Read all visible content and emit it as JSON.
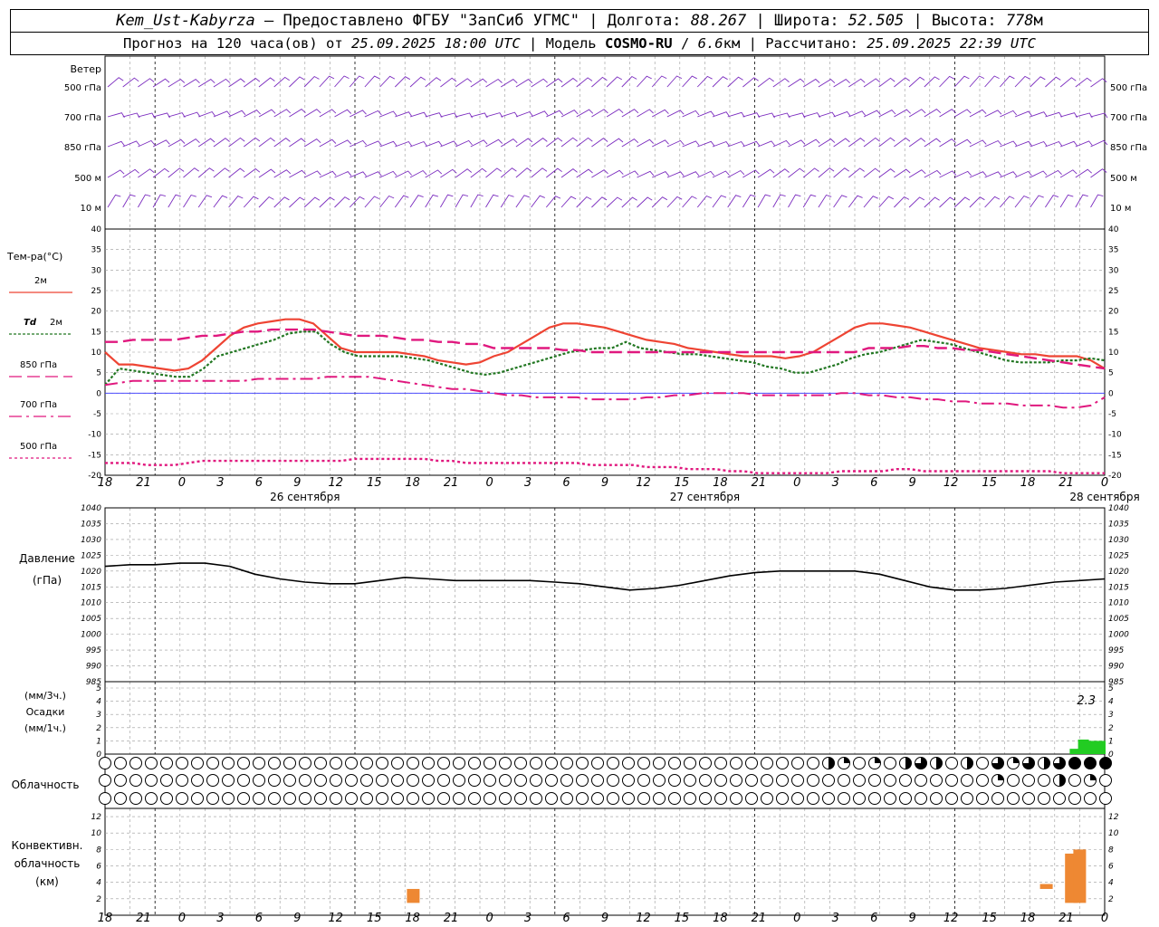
{
  "header": {
    "station": "Kem_Ust-Kabyrza",
    "provider_sep": " – Предоставлено ФГБУ \"ЗапСиб УГМС\" | Долгота: ",
    "lon": "88.267",
    "lat_label": " | Широта: ",
    "lat": "52.505",
    "alt_label": " | Высота: ",
    "alt": "778",
    "alt_unit": "м",
    "forecast_label": "Прогноз на 120 часа(ов) от ",
    "forecast_from": "25.09.2025 18:00 UTC",
    "model_label": "  | Модель ",
    "model": "COSMO-RU",
    "model_sep": " / ",
    "resolution": "6.6",
    "res_unit": "км",
    "calc_label": " | Рассчитано: ",
    "calculated": "25.09.2025 22:39 UTC"
  },
  "time_axis": {
    "tick_labels": [
      "18",
      "21",
      "0",
      "3",
      "6",
      "9",
      "12",
      "15",
      "18",
      "21",
      "0",
      "3",
      "6",
      "9",
      "12",
      "15",
      "18",
      "21",
      "0",
      "3",
      "6",
      "9",
      "12",
      "15",
      "18",
      "21",
      "0"
    ],
    "day_labels": [
      "26 сентября",
      "27 сентября",
      "28 сентября"
    ]
  },
  "labels": {
    "wind": "Ветер",
    "wind_levels": [
      "500 гПа",
      "700 гПа",
      "850 гПа",
      "500 м",
      "10 м"
    ],
    "temp_title": "Тем-ра(°C)",
    "temp_legend": [
      "2м",
      "Td 2м",
      "850 гПа",
      "700 гПа",
      "500 гПа"
    ],
    "pressure_title": "Давление",
    "pressure_unit": "(гПа)",
    "precip": [
      "(мм/3ч.)",
      "Осадки",
      "(мм/1ч.)"
    ],
    "precip_total": "2.3",
    "cloud": "Облачность",
    "conv": [
      "Конвективн.",
      "облачность",
      "(км)"
    ]
  },
  "colors": {
    "wind": "#7b2cbf",
    "t2m": "#ee4433",
    "td2m": "#227722",
    "t850": "#e0187e",
    "t700": "#e0187e",
    "t500": "#e0187e",
    "pressure": "#000000",
    "precip": "#22cc22",
    "conv": "#ee8833",
    "zero_line": "#3333ff",
    "grid": "#999999"
  },
  "chart_data": [
    {
      "type": "line",
      "name": "temperature",
      "x_hours": [
        0,
        3,
        6,
        9,
        12,
        15,
        18,
        21,
        24,
        27,
        30,
        33,
        36,
        39,
        42,
        45,
        48,
        51,
        54,
        57,
        60,
        63,
        66,
        69,
        72,
        75,
        78,
        81,
        84,
        87,
        90,
        93,
        96,
        99,
        102,
        105,
        108,
        111,
        114,
        117,
        120,
        123,
        126,
        129,
        132,
        135,
        138,
        141,
        144,
        147,
        150,
        153,
        156
      ],
      "ylim": [
        -20,
        40
      ],
      "ticks": [
        -20,
        -15,
        -10,
        -5,
        0,
        5,
        10,
        15,
        20,
        25,
        30,
        35,
        40
      ],
      "series": [
        {
          "name": "2м",
          "values": [
            10,
            7,
            7,
            6.5,
            6,
            5.5,
            6,
            8,
            11,
            14,
            16,
            17,
            17.5,
            18,
            18,
            17,
            14,
            11,
            10,
            10,
            10,
            10,
            9.5,
            9,
            8,
            7.5,
            7,
            7.5,
            9,
            10,
            12,
            14,
            16,
            17,
            17,
            16.5,
            16,
            15,
            14,
            13,
            12.5,
            12,
            11,
            10.5,
            10,
            9.5,
            9,
            9,
            9,
            8.5,
            9,
            10,
            12,
            14,
            16,
            17,
            17,
            16.5,
            16,
            15,
            14,
            13,
            12,
            11,
            10.5,
            10,
            9.5,
            9.5,
            9,
            9,
            9,
            8,
            6
          ]
        },
        {
          "name": "Td 2м",
          "values": [
            2,
            6,
            5.5,
            5,
            4.5,
            4,
            4,
            6,
            9,
            10,
            11,
            12,
            13,
            14.5,
            15,
            15,
            12,
            10,
            9,
            9,
            9,
            9,
            8.5,
            8,
            7,
            6,
            5,
            4.5,
            5,
            6,
            7,
            8,
            9,
            10,
            10.5,
            11,
            11,
            12.5,
            11,
            10.5,
            10,
            9.5,
            9.5,
            9,
            8.5,
            8,
            7.5,
            6.5,
            6,
            5,
            5,
            6,
            7,
            8.5,
            9.5,
            10,
            11,
            12,
            13,
            12.5,
            12,
            11,
            10,
            9,
            8,
            7.5,
            7.5,
            7.5,
            8,
            8,
            8.5,
            8
          ]
        },
        {
          "name": "850 гПа",
          "values": [
            12.5,
            12.5,
            13,
            13,
            13,
            13,
            13.5,
            14,
            14,
            14.5,
            15,
            15,
            15.5,
            15.5,
            15.5,
            15.5,
            15,
            14.5,
            14,
            14,
            14,
            13.5,
            13,
            13,
            12.5,
            12.5,
            12,
            12,
            11,
            11,
            11,
            11,
            11,
            10.5,
            10.5,
            10,
            10,
            10,
            10,
            10,
            10,
            10,
            10,
            10,
            10,
            10,
            10,
            10,
            10,
            10,
            10,
            10,
            10,
            10,
            10,
            11,
            11,
            11,
            11.5,
            11.5,
            11,
            11,
            10.5,
            10.5,
            10,
            9.5,
            9,
            8.5,
            8,
            7.5,
            7,
            6.5,
            6
          ]
        },
        {
          "name": "700 гПа",
          "values": [
            2,
            2.5,
            3,
            3,
            3,
            3,
            3,
            3,
            3,
            3,
            3,
            3.5,
            3.5,
            3.5,
            3.5,
            3.5,
            4,
            4,
            4,
            4,
            3.5,
            3,
            2.5,
            2,
            1.5,
            1,
            1,
            0.5,
            0,
            -0.5,
            -0.5,
            -1,
            -1,
            -1,
            -1,
            -1.5,
            -1.5,
            -1.5,
            -1.5,
            -1,
            -1,
            -0.5,
            -0.5,
            0,
            0,
            0,
            0,
            -0.5,
            -0.5,
            -0.5,
            -0.5,
            -0.5,
            -0.5,
            0,
            0,
            -0.5,
            -0.5,
            -1,
            -1,
            -1.5,
            -1.5,
            -2,
            -2,
            -2.5,
            -2.5,
            -2.5,
            -3,
            -3,
            -3,
            -3.5,
            -3.5,
            -3,
            -1
          ]
        },
        {
          "name": "500 гПа",
          "values": [
            -17,
            -17,
            -17,
            -17.5,
            -17.5,
            -17.5,
            -17,
            -16.5,
            -16.5,
            -16.5,
            -16.5,
            -16.5,
            -16.5,
            -16.5,
            -16.5,
            -16.5,
            -16.5,
            -16.5,
            -16,
            -16,
            -16,
            -16,
            -16,
            -16,
            -16.5,
            -16.5,
            -17,
            -17,
            -17,
            -17,
            -17,
            -17,
            -17,
            -17,
            -17,
            -17.5,
            -17.5,
            -17.5,
            -17.5,
            -18,
            -18,
            -18,
            -18.5,
            -18.5,
            -18.5,
            -19,
            -19,
            -19.5,
            -19.5,
            -19.5,
            -19.5,
            -19.5,
            -19.5,
            -19,
            -19,
            -19,
            -19,
            -18.5,
            -18.5,
            -19,
            -19,
            -19,
            -19,
            -19,
            -19,
            -19,
            -19,
            -19,
            -19,
            -19.5,
            -19.5,
            -19.5,
            -19.5
          ]
        }
      ]
    },
    {
      "type": "line",
      "name": "pressure",
      "ylim": [
        985,
        1040
      ],
      "ticks": [
        985,
        990,
        995,
        1000,
        1005,
        1010,
        1015,
        1020,
        1025,
        1030,
        1035,
        1040
      ],
      "x_hours": [
        0,
        3,
        6,
        9,
        12,
        15,
        18,
        21,
        24,
        27,
        30,
        33,
        36,
        39,
        42,
        45,
        48,
        51,
        54,
        57,
        60,
        63,
        66,
        69,
        72,
        75,
        78,
        81,
        84,
        87,
        90,
        93,
        96,
        99,
        102,
        105,
        108,
        111,
        114,
        117,
        120
      ],
      "values": [
        1021.5,
        1022,
        1022,
        1022.5,
        1022.5,
        1021.5,
        1019,
        1017.5,
        1016.5,
        1016,
        1016,
        1017,
        1018,
        1017.5,
        1017,
        1017,
        1017,
        1017,
        1016.5,
        1016,
        1015,
        1014,
        1014.5,
        1015.5,
        1017,
        1018.5,
        1019.5,
        1020,
        1020,
        1020,
        1020,
        1019,
        1017,
        1015,
        1014,
        1014,
        1014.5,
        1015.5,
        1016.5,
        1017,
        1017.5
      ]
    },
    {
      "type": "bar",
      "name": "precipitation",
      "ylim": [
        0,
        5
      ],
      "ticks": [
        0,
        1,
        2,
        3,
        4,
        5
      ],
      "x_hours": [
        117,
        118,
        119,
        120
      ],
      "values": [
        0.4,
        1.1,
        1.0,
        1.0
      ]
    },
    {
      "type": "bar",
      "name": "convective cloud",
      "ylim": [
        0,
        13
      ],
      "ticks": [
        2,
        4,
        6,
        8,
        10,
        12
      ],
      "bars": [
        {
          "x_hours": 37,
          "width_hours": 1,
          "bottom": 1.5,
          "top": 3.2
        },
        {
          "x_hours": 113,
          "width_hours": 1,
          "bottom": 3.2,
          "top": 3.8
        },
        {
          "x_hours": 116,
          "width_hours": 1,
          "bottom": 1.5,
          "top": 7.5
        },
        {
          "x_hours": 117,
          "width_hours": 1,
          "bottom": 1.5,
          "top": 8.0
        }
      ]
    },
    {
      "type": "table",
      "name": "cloudiness",
      "rows": 3,
      "columns": 66,
      "note_levels": "0=clear,1=quarter,2=half,3=three-quarter,4=overcast",
      "upper": [
        0,
        0,
        0,
        0,
        0,
        0,
        0,
        0,
        0,
        0,
        0,
        0,
        0,
        0,
        0,
        0,
        0,
        0,
        0,
        0,
        0,
        0,
        0,
        0,
        0,
        0,
        0,
        0,
        0,
        0,
        0,
        0,
        0,
        0,
        0,
        0,
        0,
        0,
        0,
        0,
        0,
        0,
        0,
        0,
        0,
        0,
        0,
        2,
        1,
        0,
        1,
        0,
        2,
        3,
        2,
        0,
        2,
        0,
        3,
        1,
        3,
        2,
        3,
        4,
        4,
        4,
        3,
        2,
        1,
        1,
        1,
        0,
        0,
        0,
        0,
        0
      ],
      "middle": [
        0,
        0,
        0,
        0,
        0,
        0,
        0,
        0,
        0,
        0,
        0,
        0,
        0,
        0,
        0,
        0,
        0,
        0,
        0,
        0,
        0,
        0,
        0,
        0,
        0,
        0,
        0,
        0,
        0,
        0,
        0,
        0,
        0,
        0,
        0,
        0,
        0,
        0,
        0,
        0,
        0,
        0,
        0,
        0,
        0,
        0,
        0,
        0,
        0,
        0,
        0,
        0,
        0,
        0,
        0,
        0,
        0,
        0,
        1,
        0,
        0,
        0,
        2,
        0,
        1,
        0,
        0,
        1,
        1,
        3,
        4,
        3,
        2,
        3,
        2,
        2,
        3,
        4,
        4,
        4
      ],
      "low": [
        0,
        0,
        0,
        0,
        0,
        0,
        0,
        0,
        0,
        0,
        0,
        0,
        0,
        0,
        0,
        0,
        0,
        0,
        0,
        0,
        0,
        0,
        0,
        0,
        0,
        0,
        0,
        0,
        0,
        0,
        0,
        0,
        0,
        0,
        0,
        0,
        0,
        0,
        0,
        0,
        0,
        0,
        0,
        0,
        0,
        0,
        0,
        0,
        0,
        0,
        0,
        0,
        0,
        0,
        0,
        0,
        0,
        0,
        0,
        0,
        0,
        0,
        0,
        0,
        0,
        0,
        0,
        0,
        0,
        0,
        0,
        0,
        2,
        3,
        4,
        4
      ]
    },
    {
      "type": "scatter",
      "name": "wind",
      "rows": [
        "500 гПа",
        "700 гПа",
        "850 гПа",
        "500 м",
        "10 м"
      ],
      "speed_level": [
        25,
        10,
        12,
        10,
        5
      ],
      "columns": 66
    }
  ]
}
